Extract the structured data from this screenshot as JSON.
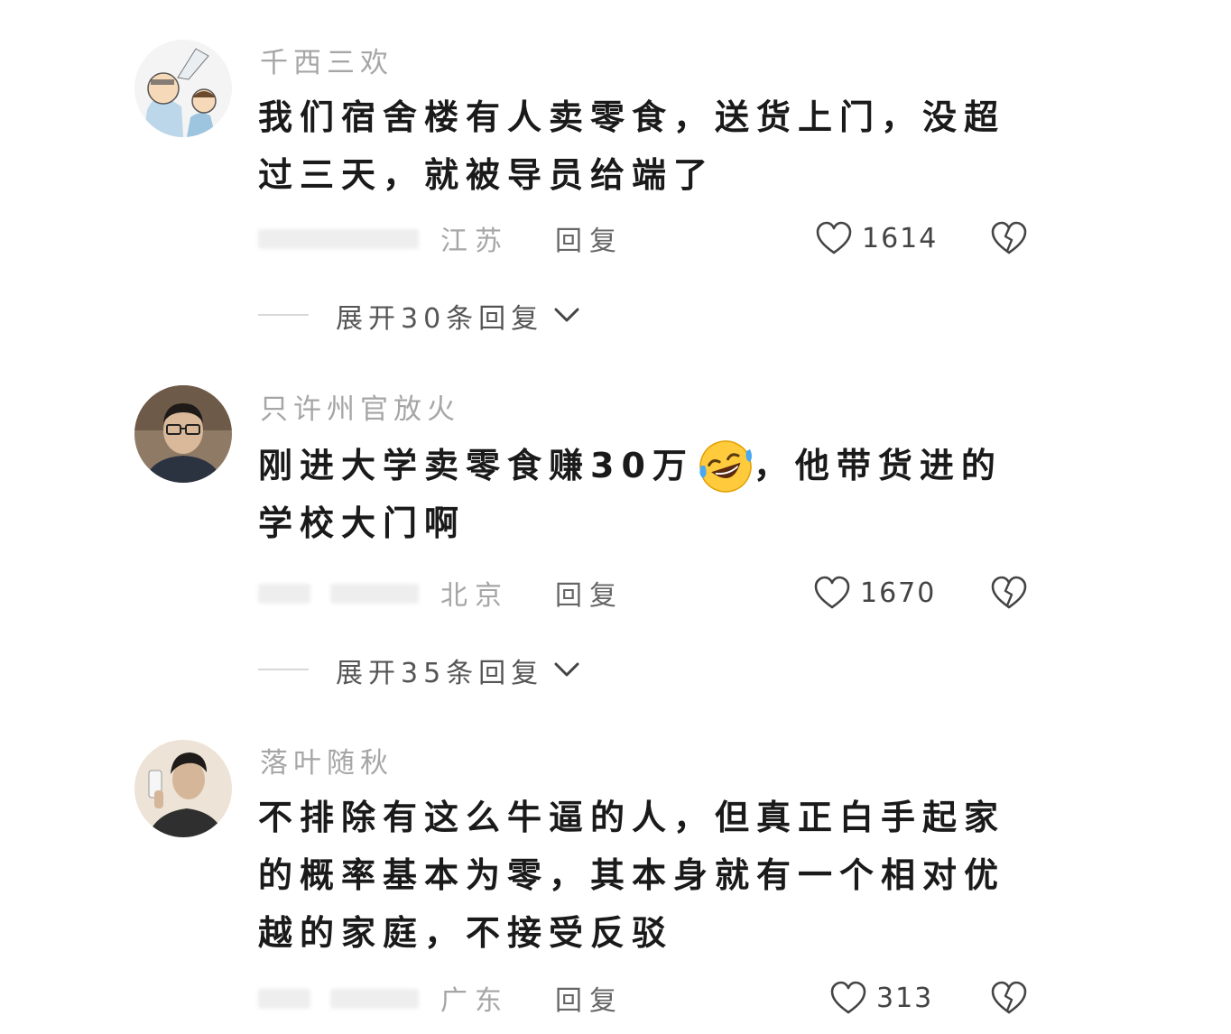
{
  "comments": [
    {
      "username": "千西三欢",
      "text": "我们宿舍楼有人卖零食，送货上门，没超过三天，就被导员给端了",
      "location": "江苏",
      "reply_label": "回复",
      "likes": "1614",
      "expand_label": "展开30条回复",
      "avatar_icon": "cartoon-kids-avatar"
    },
    {
      "username": "只许州官放火",
      "text_before": "刚进大学卖零食赚30万",
      "text_after": "，他带货进的学校大门啊",
      "emoji": "rofl-emoji",
      "location": "北京",
      "reply_label": "回复",
      "likes": "1670",
      "expand_label": "展开35条回复",
      "avatar_icon": "man-glasses-avatar"
    },
    {
      "username": "落叶随秋",
      "text": "不排除有这么牛逼的人，但真正白手起家的概率基本为零，其本身就有一个相对优越的家庭，不接受反驳",
      "location": "广东",
      "reply_label": "回复",
      "likes": "313",
      "avatar_icon": "sketch-man-avatar"
    }
  ],
  "icons": {
    "like": "heart-outline-icon",
    "dislike": "broken-heart-icon",
    "expand": "chevron-down-icon"
  },
  "colors": {
    "username": "#a6a6a6",
    "text": "#1a1a1a",
    "meta": "#a6a6a6"
  }
}
